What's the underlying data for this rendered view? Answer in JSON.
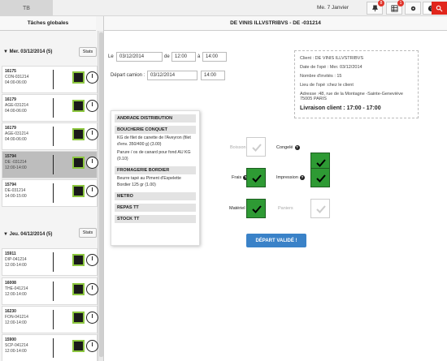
{
  "topbar": {
    "app_label": "TB",
    "date": "Me. 7 Janvier",
    "badges": [
      "8",
      "1"
    ]
  },
  "sidebar": {
    "title": "Tâches globales",
    "day1": {
      "label": "Mer. 03/12/2014 (5)",
      "stats": "Stats"
    },
    "day2": {
      "label": "Jeu. 04/12/2014 (5)",
      "stats": "Stats"
    },
    "tasks1": [
      {
        "num": "16175",
        "code": "CON-031214",
        "time": "04:00-06:00"
      },
      {
        "num": "16179",
        "code": "AGE-031214",
        "time": "04:00-06:00"
      },
      {
        "num": "16179",
        "code": "AGE-031214",
        "time": "04:00-06:00"
      },
      {
        "num": "15794",
        "code": "DE -031214",
        "time": "12:00-14:00"
      },
      {
        "num": "15794",
        "code": "DE-031214",
        "time": "14:00-15:00"
      }
    ],
    "tasks2": [
      {
        "num": "15911",
        "code": "DIP-041214",
        "time": "12:00-14:00"
      },
      {
        "num": "16008",
        "code": "THE-041214",
        "time": "12:00-14:00"
      },
      {
        "num": "16230",
        "code": "FON-041214",
        "time": "12:00-14:00"
      },
      {
        "num": "15900",
        "code": "SCP-041214",
        "time": "12:00-14:00"
      }
    ]
  },
  "main": {
    "header": "DE VINIS ILLVSTRIBVS - DE -031214",
    "le_label": "Le",
    "le_date": "03/12/2014",
    "de_label": "de",
    "de_time": "12:00",
    "a_label": "à",
    "a_time": "14:00",
    "depart_label": "Départ camion :",
    "depart_date": "03/12/2014",
    "depart_time": "14:00",
    "client": {
      "client": "Client : DE VINIS ILLVSTRIBVS",
      "date": "Date de l'opé : Mer. 03/12/2014",
      "invites": "Nombre d'invités : 15",
      "lieu": "Lieu de l'opé :chez le client",
      "adresse": "Adresse :48, rue de la Montagne -Sainte-Geneviève 75005 PARIS",
      "livraison": "Livraison client : 17:00 - 17:00"
    },
    "suppliers": {
      "s1": "ANDRADE DISTRIBUTION",
      "s2": "BOUCHERIE CONQUET",
      "s2_items": "KG de filet de canette de l'Aveyron (filet d'env. 350/400 g) (3.00)",
      "s2_items2": "Parure / os de canard pour fond AU KG (0.10)",
      "s3": "FROMAGERIE BORDIER",
      "s3_items": "Beurre tapé au Piment d'Espelette Bordier 125 gr (1.00)",
      "s4": "METRO",
      "s5": "REPAS TT",
      "s6": "STOCK TT"
    },
    "options": {
      "boisson": "Boisson",
      "congele": "Congelé",
      "frais": "Frais",
      "impression": "Impression",
      "materiel": "Matériel",
      "paniers": "Paniers"
    },
    "button": "DÉPART VALIDÉ !"
  }
}
